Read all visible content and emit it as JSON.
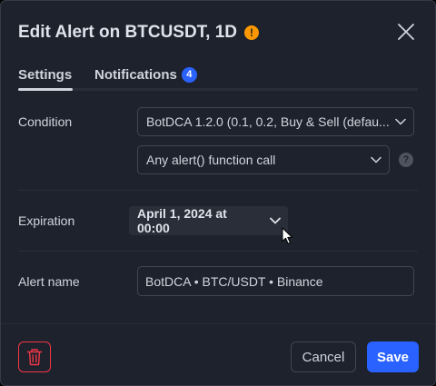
{
  "header": {
    "title": "Edit Alert on BTCUSDT, 1D",
    "warning_icon": "!"
  },
  "tabs": [
    {
      "label": "Settings",
      "active": true
    },
    {
      "label": "Notifications",
      "badge": "4"
    }
  ],
  "condition": {
    "label": "Condition",
    "indicator": "BotDCA 1.2.0 (0.1, 0.2, Buy & Sell (defau...",
    "trigger": "Any alert() function call",
    "help": "?"
  },
  "expiration": {
    "label": "Expiration",
    "value": "April 1, 2024 at 00:00"
  },
  "alert_name": {
    "label": "Alert name",
    "value": "BotDCA • BTC/USDT • Binance"
  },
  "footer": {
    "cancel_label": "Cancel",
    "save_label": "Save"
  },
  "colors": {
    "accent": "#2962ff",
    "warning": "#ff9800",
    "danger": "#f23645",
    "background": "#1e222d"
  }
}
